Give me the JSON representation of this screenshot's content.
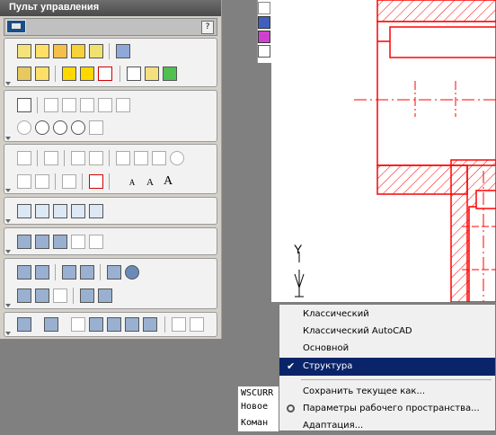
{
  "panel": {
    "title": "Пульт управления",
    "help_label": "?"
  },
  "toolbar_text": {
    "text_small": "A",
    "text_medium": "A",
    "text_large": "A"
  },
  "menu": {
    "items": [
      {
        "label": "Классический",
        "checked": false
      },
      {
        "label": "Классический AutoCAD",
        "checked": false
      },
      {
        "label": "Основной",
        "checked": false
      },
      {
        "label": "Структура",
        "checked": true
      },
      {
        "label": "Сохранить текущее как..."
      },
      {
        "label": "Параметры рабочего пространства..."
      },
      {
        "label": "Адаптация..."
      }
    ],
    "check_glyph": "✔"
  },
  "command": {
    "lines": [
      "WSCURR",
      "Новое",
      "Коман"
    ]
  },
  "ucs": {
    "y_label": "Y"
  },
  "colors": {
    "selected": "#0a246a",
    "hatch": "#ff0000"
  }
}
